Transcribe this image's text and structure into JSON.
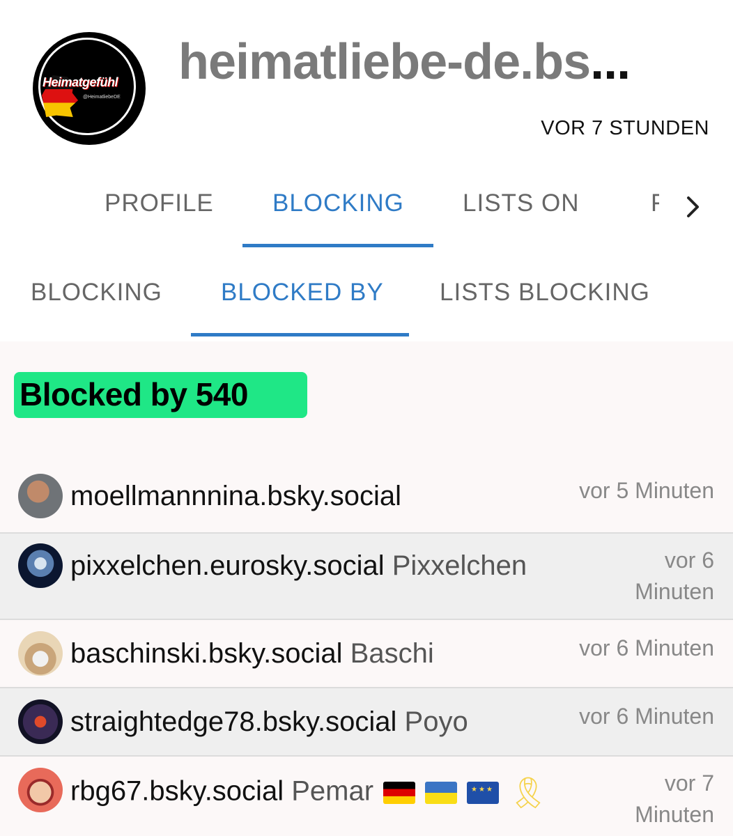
{
  "profile": {
    "title": "heimatliebe-de.bs",
    "title_ellipsis": "...",
    "updated": "VOR 7 STUNDEN",
    "avatar_brand": "Heimatgefühl",
    "avatar_handle": "@HeimatliebeDE"
  },
  "main_tabs": [
    {
      "label": "PROFILE",
      "active": false
    },
    {
      "label": "BLOCKING",
      "active": true
    },
    {
      "label": "LISTS ON",
      "active": false
    },
    {
      "label": "F",
      "active": false
    }
  ],
  "sub_tabs": [
    {
      "label": "BLOCKING",
      "active": false
    },
    {
      "label": "BLOCKED BY",
      "active": true
    },
    {
      "label": "LISTS BLOCKING",
      "active": false
    }
  ],
  "summary_badge": "Blocked by 540",
  "rows": [
    {
      "handle": "moellmannnina.bsky.social",
      "display_name": "",
      "time_line1": "vor 5 Minuten",
      "time_line2": ""
    },
    {
      "handle": "pixxelchen.eurosky.social",
      "display_name": "Pixxelchen",
      "time_line1": "vor 6",
      "time_line2": "Minuten"
    },
    {
      "handle": "baschinski.bsky.social",
      "display_name": "Baschi",
      "time_line1": "vor 6 Minuten",
      "time_line2": ""
    },
    {
      "handle": "straightedge78.bsky.social",
      "display_name": "Poyo",
      "time_line1": "vor 6 Minuten",
      "time_line2": ""
    },
    {
      "handle": "rbg67.bsky.social",
      "display_name": "Pemar",
      "time_line1": "vor 7",
      "time_line2": "Minuten"
    }
  ],
  "colors": {
    "accent": "#2f7bc6",
    "badge": "#1fe786",
    "row_alt": "#efefef",
    "content_bg": "#fcf8f8"
  },
  "icons": {
    "tabs_next": "chevron-right-icon",
    "row5_extras": [
      "flag-germany-icon",
      "flag-ukraine-icon",
      "flag-eu-icon",
      "yellow-ribbon-icon"
    ]
  }
}
